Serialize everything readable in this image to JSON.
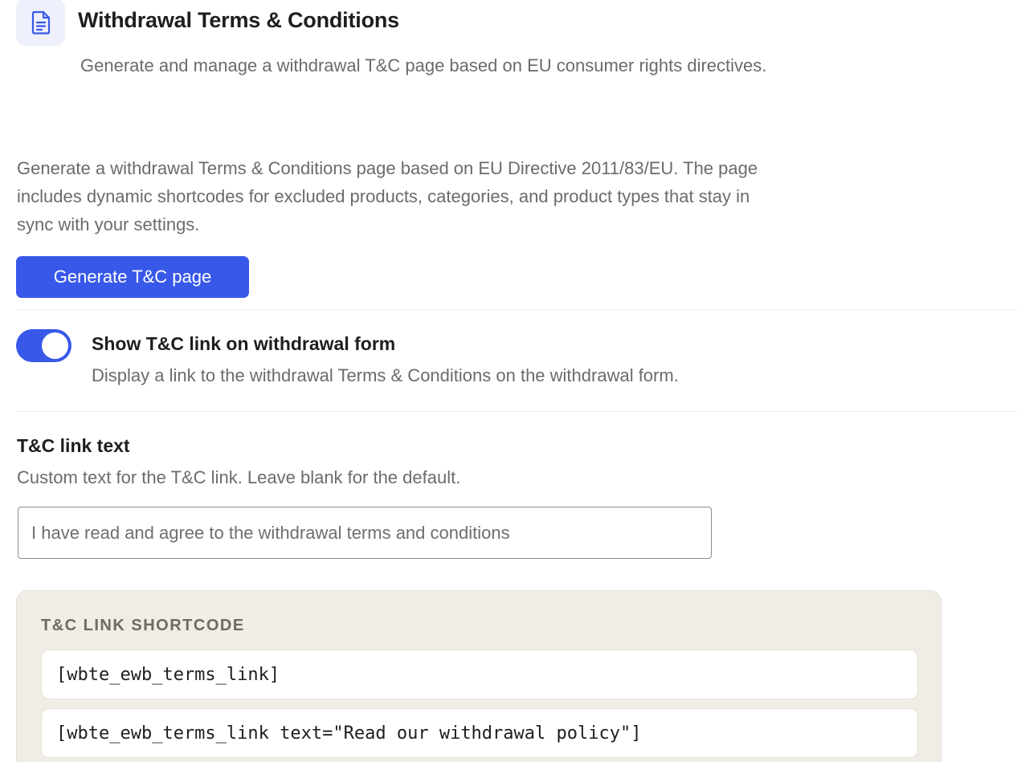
{
  "header": {
    "icon": "document-icon",
    "title": "Withdrawal Terms & Conditions",
    "subtitle": "Generate and manage a withdrawal T&C page based on EU consumer rights directives."
  },
  "intro": {
    "text": "Generate a withdrawal Terms & Conditions page based on EU Directive 2011/83/EU. The page includes dynamic shortcodes for excluded products, categories, and product types that stay in sync with your settings."
  },
  "generate_button": {
    "label": "Generate T&C page"
  },
  "show_link_toggle": {
    "enabled": true,
    "label": "Show T&C link on withdrawal form",
    "description": "Display a link to the withdrawal Terms & Conditions on the withdrawal form."
  },
  "link_text_field": {
    "label": "T&C link text",
    "help": "Custom text for the T&C link. Leave blank for the default.",
    "value": "",
    "placeholder": "I have read and agree to the withdrawal terms and conditions"
  },
  "shortcode_panel": {
    "title": "T&C LINK SHORTCODE",
    "shortcodes": [
      "[wbte_ewb_terms_link]",
      "[wbte_ewb_terms_link text=\"Read our withdrawal policy\"]"
    ]
  },
  "colors": {
    "accent": "#3858e9",
    "icon_bg": "#eef0fb",
    "panel_bg": "#f0ede6",
    "muted_text": "#6b6b6b"
  }
}
